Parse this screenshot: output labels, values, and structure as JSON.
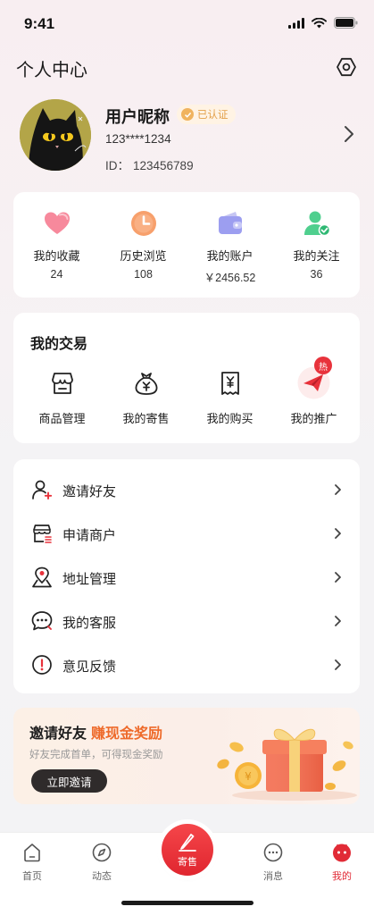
{
  "status_bar": {
    "time": "9:41"
  },
  "header": {
    "title": "个人中心"
  },
  "profile": {
    "nickname": "用户昵称",
    "verified_label": "已认证",
    "phone": "123****1234",
    "id_label": "ID：",
    "id_value": "123456789"
  },
  "stats": [
    {
      "label": "我的收藏",
      "value": "24",
      "icon": "heart-icon"
    },
    {
      "label": "历史浏览",
      "value": "108",
      "icon": "clock-icon"
    },
    {
      "label": "我的账户",
      "value": "￥2456.52",
      "icon": "wallet-icon"
    },
    {
      "label": "我的关注",
      "value": "36",
      "icon": "user-check-icon"
    }
  ],
  "trades": {
    "title": "我的交易",
    "items": [
      {
        "label": "商品管理",
        "icon": "store-icon"
      },
      {
        "label": "我的寄售",
        "icon": "money-bag-icon"
      },
      {
        "label": "我的购买",
        "icon": "receipt-icon"
      },
      {
        "label": "我的推广",
        "icon": "paper-plane-icon"
      }
    ],
    "hot_badge": "热"
  },
  "menu": [
    {
      "label": "邀请好友",
      "icon": "user-add-icon"
    },
    {
      "label": "申请商户",
      "icon": "shop-icon"
    },
    {
      "label": "地址管理",
      "icon": "location-icon"
    },
    {
      "label": "我的客服",
      "icon": "chat-icon"
    },
    {
      "label": "意见反馈",
      "icon": "alert-icon"
    }
  ],
  "promo": {
    "title": "邀请好友",
    "highlight": "赚现金奖励",
    "subtitle": "好友完成首单，可得现金奖励",
    "button": "立即邀请"
  },
  "tabbar": {
    "tabs": [
      {
        "label": "首页",
        "icon": "home-icon"
      },
      {
        "label": "动态",
        "icon": "compass-icon"
      },
      {
        "label": "寄售",
        "icon": "edit-icon"
      },
      {
        "label": "消息",
        "icon": "message-icon"
      },
      {
        "label": "我的",
        "icon": "profile-icon"
      }
    ],
    "active_index": 4
  },
  "colors": {
    "accent": "#e12b36",
    "promo_highlight": "#ee6a2a",
    "verified": "#e3a04b"
  }
}
